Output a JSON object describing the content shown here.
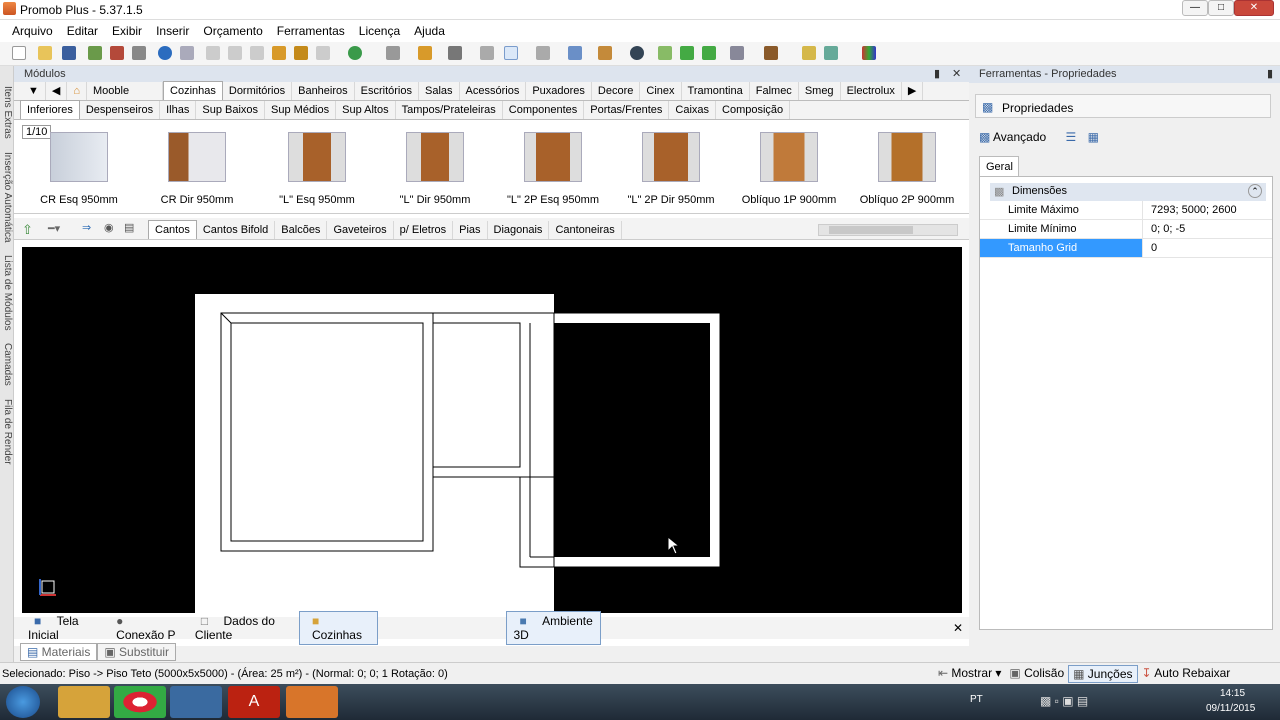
{
  "window": {
    "title": "Promob Plus - 5.37.1.5"
  },
  "menu": [
    "Arquivo",
    "Editar",
    "Exibir",
    "Inserir",
    "Orçamento",
    "Ferramentas",
    "Licença",
    "Ajuda"
  ],
  "left_strip": [
    "Itens Extras",
    "Inserção Automática",
    "Lista de Módulos",
    "Camadas",
    "Fila de Render"
  ],
  "modules": {
    "header": "Módulos",
    "brand": "Mooble",
    "category_tabs": [
      "Cozinhas",
      "Dormitórios",
      "Banheiros",
      "Escritórios",
      "Salas",
      "Acessórios",
      "Puxadores",
      "Decore",
      "Cinex",
      "Tramontina",
      "Falmec",
      "Smeg",
      "Electrolux"
    ],
    "subcategory_tabs": [
      "Inferiores",
      "Despenseiros",
      "Ilhas",
      "Sup Baixos",
      "Sup Médios",
      "Sup Altos",
      "Tampos/Prateleiras",
      "Componentes",
      "Portas/Frentes",
      "Caixas",
      "Composição"
    ],
    "page_indicator": "1/10",
    "items": [
      "CR Esq 950mm",
      "CR Dir 950mm",
      "\"L\" Esq 950mm",
      "\"L\" Dir 950mm",
      "\"L\" 2P Esq 950mm",
      "\"L\" 2P Dir 950mm",
      "Oblíquo 1P 900mm",
      "Oblíquo 2P 900mm"
    ],
    "type_tabs": [
      "Cantos",
      "Cantos Bifold",
      "Balcões",
      "Gaveteiros",
      "p/ Eletros",
      "Pias",
      "Diagonais",
      "Cantoneiras"
    ]
  },
  "bottom_tabs": [
    "Tela Inicial",
    "Conexão P",
    "Dados do Cliente",
    "Cozinhas",
    "Ambiente 3D"
  ],
  "lower_tabs": [
    "Materiais",
    "Substituir"
  ],
  "properties": {
    "header": "Ferramentas - Propriedades",
    "section": "Propriedades",
    "advanced": "Avançado",
    "tab": "Geral",
    "group": "Dimensões",
    "rows": [
      {
        "key": "Limite Máximo",
        "value": "7293; 5000; 2600"
      },
      {
        "key": "Limite Mínimo",
        "value": "0; 0; -5"
      },
      {
        "key": "Tamanho Grid",
        "value": "0"
      }
    ]
  },
  "status": {
    "text": "Selecionado: Piso -> Piso Teto (5000x5x5000) - (Área: 25 m²) - (Normal: 0; 0; 1 Rotação: 0)",
    "buttons": [
      "Mostrar",
      "Colisão",
      "Junções",
      "Auto Rebaixar"
    ]
  },
  "taskbar": {
    "lang": "PT",
    "time": "14:15",
    "date": "09/11/2015"
  }
}
